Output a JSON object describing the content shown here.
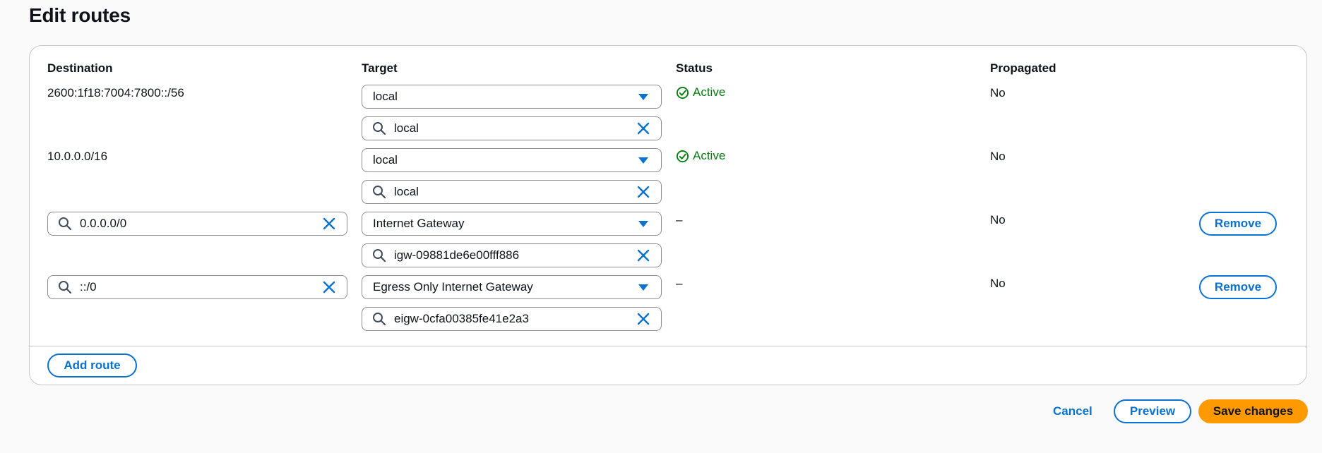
{
  "page": {
    "title": "Edit routes"
  },
  "columns": {
    "destination": "Destination",
    "target": "Target",
    "status": "Status",
    "propagated": "Propagated"
  },
  "routes": [
    {
      "destination": "2600:1f18:7004:7800::/56",
      "target_type": "local",
      "target_id": "local",
      "status": "Active",
      "propagated": "No"
    },
    {
      "destination": "10.0.0.0/16",
      "target_type": "local",
      "target_id": "local",
      "status": "Active",
      "propagated": "No"
    },
    {
      "destination": "0.0.0.0/0",
      "target_type": "Internet Gateway",
      "target_id": "igw-09881de6e00fff886",
      "status": "–",
      "propagated": "No",
      "remove_label": "Remove"
    },
    {
      "destination": "::/0",
      "target_type": "Egress Only Internet Gateway",
      "target_id": "eigw-0cfa00385fe41e2a3",
      "status": "–",
      "propagated": "No",
      "remove_label": "Remove"
    }
  ],
  "actions": {
    "add_route": "Add route",
    "cancel": "Cancel",
    "preview": "Preview",
    "save": "Save changes"
  },
  "icons": {
    "select_caret": "caret-down-icon",
    "search": "search-icon",
    "clear": "close-icon",
    "status_ok": "check-circle-icon"
  },
  "colors": {
    "accent": "#0972d3",
    "success": "#037f0c",
    "primary_button": "#ff9900",
    "border": "#c6c6cd"
  }
}
